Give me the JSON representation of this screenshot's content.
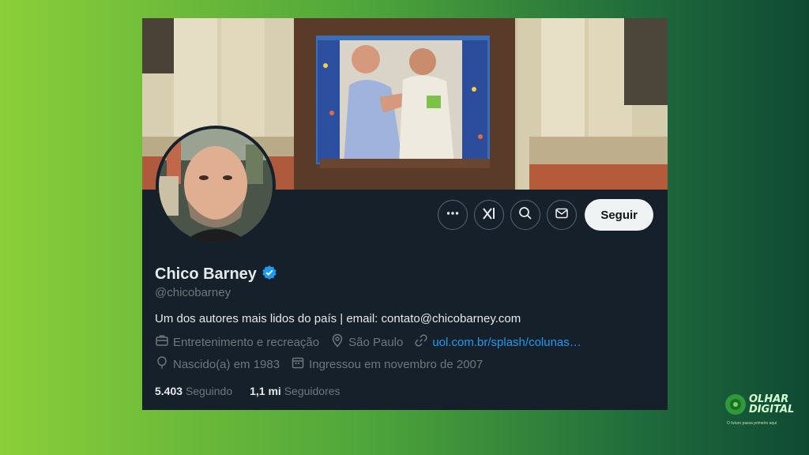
{
  "profile": {
    "name": "Chico Barney",
    "verified": true,
    "handle": "@chicobarney",
    "bio": "Um dos autores mais lidos do país  | email: contato@chicobarney.com",
    "category": "Entretenimento e recreação",
    "location": "São Paulo",
    "link": "uol.com.br/splash/colunas…",
    "birth": "Nascido(a) em 1983",
    "joined": "Ingressou em novembro de 2007",
    "following_count": "5.403",
    "following_label": "Seguindo",
    "followers_count": "1,1 mi",
    "followers_label": "Seguidores"
  },
  "actions": {
    "follow_label": "Seguir",
    "icons": [
      "more-icon",
      "grok-icon",
      "search-icon",
      "message-icon"
    ]
  },
  "watermark": {
    "brand_line1": "OLHAR",
    "brand_line2": "DIGITAL",
    "tagline": "O futuro passa primeiro aqui"
  },
  "colors": {
    "card_bg": "#15202b",
    "link": "#1d9bf0",
    "muted": "#71767b",
    "verified": "#1d9bf0",
    "follow_bg": "#eff3f4"
  }
}
